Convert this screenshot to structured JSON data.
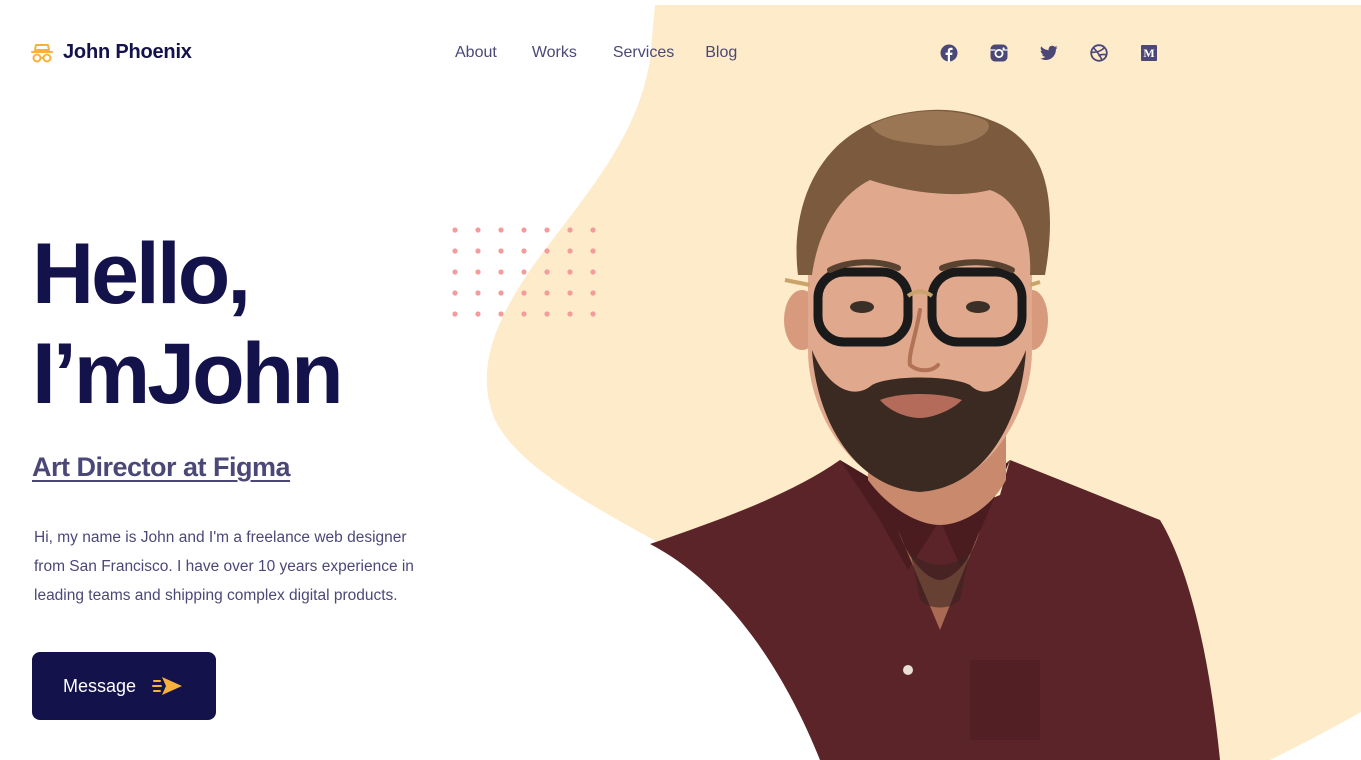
{
  "colors": {
    "navy": "#14124a",
    "muted": "#4b4878",
    "accent_orange": "#f7b23b",
    "blob_cream": "#fdebc9",
    "dots_pink": "#f49b9b"
  },
  "header": {
    "brand": "John Phoenix",
    "logo_icon": "spy-glasses-icon",
    "nav": [
      "About",
      "Works",
      "Services",
      "Blog"
    ],
    "socials": [
      "facebook-icon",
      "instagram-icon",
      "twitter-icon",
      "dribbble-icon",
      "medium-icon"
    ]
  },
  "hero": {
    "greeting": "Hello,",
    "intro": "I’m",
    "name": "John",
    "role": "Art Director at Figma",
    "bio": "Hi, my name is John and I'm a freelance web designer from San Francisco. I have over 10 years experience in leading teams and shipping complex digital products.",
    "cta_label": "Message",
    "cta_icon": "paper-plane-icon"
  },
  "media": {
    "portrait": "portrait-photo"
  }
}
